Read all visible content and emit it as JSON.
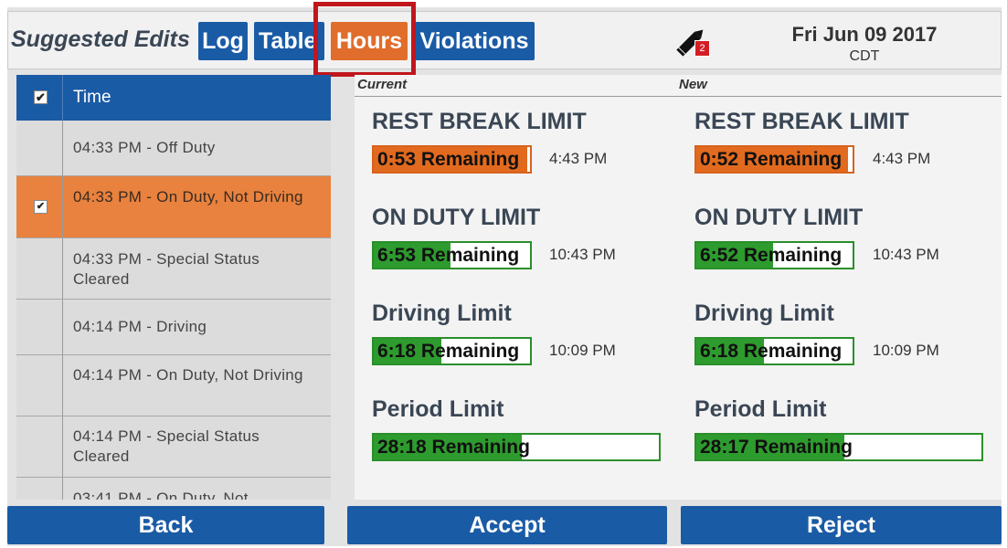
{
  "header": {
    "title": "Suggested Edits",
    "tabs": [
      {
        "label": "Log",
        "active": false
      },
      {
        "label": "Table",
        "active": false
      },
      {
        "label": "Hours",
        "active": true
      },
      {
        "label": "Violations",
        "active": false
      }
    ],
    "edit_icon": "pencil-icon",
    "edit_badge": "2",
    "date": "Fri Jun 09 2017",
    "timezone": "CDT"
  },
  "list": {
    "header_label": "Time",
    "header_checked": true,
    "rows": [
      {
        "label": "04:33 PM - Off Duty",
        "selected": false
      },
      {
        "label": "04:33 PM - On Duty, Not Driving",
        "selected": true
      },
      {
        "label": "04:33 PM - Special Status Cleared",
        "selected": false
      },
      {
        "label": "04:14 PM - Driving",
        "selected": false
      },
      {
        "label": "04:14 PM - On Duty, Not Driving",
        "selected": false
      },
      {
        "label": "04:14 PM - Special Status Cleared",
        "selected": false
      },
      {
        "label": "03:41 PM - On Duty, Not",
        "selected": false
      }
    ]
  },
  "panel": {
    "current_label": "Current",
    "new_label": "New",
    "current": [
      {
        "title": "REST BREAK LIMIT",
        "remaining": "0:53 Remaining",
        "fill": 0.98,
        "color": "#e26a1e",
        "at": "4:43 PM"
      },
      {
        "title": "ON DUTY LIMIT",
        "remaining": "6:53 Remaining",
        "fill": 0.49,
        "color": "#2e9b2e",
        "at": "10:43 PM"
      },
      {
        "title": "Driving Limit",
        "remaining": "6:18 Remaining",
        "fill": 0.43,
        "color": "#2e9b2e",
        "at": "10:09 PM"
      },
      {
        "title": "Period Limit",
        "remaining": "28:18 Remaining",
        "fill": 0.52,
        "color": "#2e9b2e",
        "at": ""
      }
    ],
    "new": [
      {
        "title": "REST BREAK LIMIT",
        "remaining": "0:52 Remaining",
        "fill": 0.97,
        "color": "#e26a1e",
        "at": "4:43 PM"
      },
      {
        "title": "ON DUTY LIMIT",
        "remaining": "6:52 Remaining",
        "fill": 0.49,
        "color": "#2e9b2e",
        "at": "10:43 PM"
      },
      {
        "title": "Driving Limit",
        "remaining": "6:18 Remaining",
        "fill": 0.43,
        "color": "#2e9b2e",
        "at": "10:09 PM"
      },
      {
        "title": "Period Limit",
        "remaining": "28:17 Remaining",
        "fill": 0.52,
        "color": "#2e9b2e",
        "at": ""
      }
    ]
  },
  "footer": {
    "back_label": "Back",
    "accept_label": "Accept",
    "reject_label": "Reject"
  },
  "colors": {
    "primary": "#1a5ba5",
    "active_tab": "#e06d2b",
    "highlight_box": "#c0161c",
    "selected_row": "#e8823e",
    "green_fill": "#2e9b2e"
  }
}
